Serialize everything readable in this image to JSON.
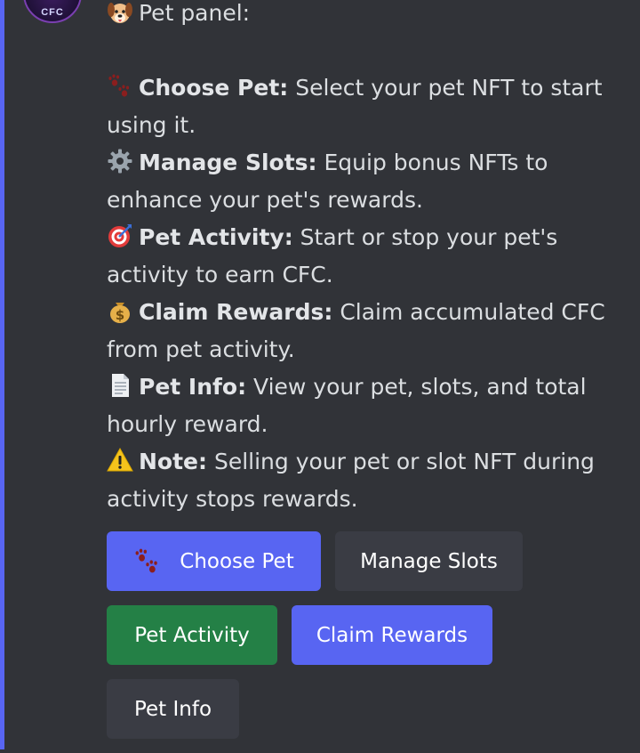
{
  "message": {
    "heading_text": "Pet panel:",
    "heading_icon": "dog-face-icon",
    "items": [
      {
        "icon": "paw-prints-icon",
        "title": "Choose Pet:",
        "text": " Select your pet NFT to start using it."
      },
      {
        "icon": "gear-icon",
        "title": "Manage Slots:",
        "text": " Equip bonus NFTs to enhance your pet's rewards."
      },
      {
        "icon": "target-icon",
        "title": "Pet Activity:",
        "text": " Start or stop your pet's activity to earn CFC."
      },
      {
        "icon": "money-bag-icon",
        "title": "Claim Rewards:",
        "text": " Claim accumulated CFC from pet activity."
      },
      {
        "icon": "document-icon",
        "title": "Pet Info:",
        "text": " View your pet, slots, and total hourly reward."
      },
      {
        "icon": "warning-icon",
        "title": "Note:",
        "text": " Selling your pet or slot NFT during activity stops rewards."
      }
    ]
  },
  "avatar": {
    "text": "CFC"
  },
  "buttons": {
    "choose_pet": {
      "label": "Choose Pet",
      "icon": "paw-prints-icon"
    },
    "manage_slots": {
      "label": "Manage Slots"
    },
    "pet_activity": {
      "label": "Pet Activity"
    },
    "claim_rewards": {
      "label": "Claim Rewards"
    },
    "pet_info": {
      "label": "Pet Info"
    }
  },
  "colors": {
    "background": "#313338",
    "primary": "#5865f2",
    "secondary": "#3a3c44",
    "success": "#248046",
    "text": "#dbdee1"
  }
}
